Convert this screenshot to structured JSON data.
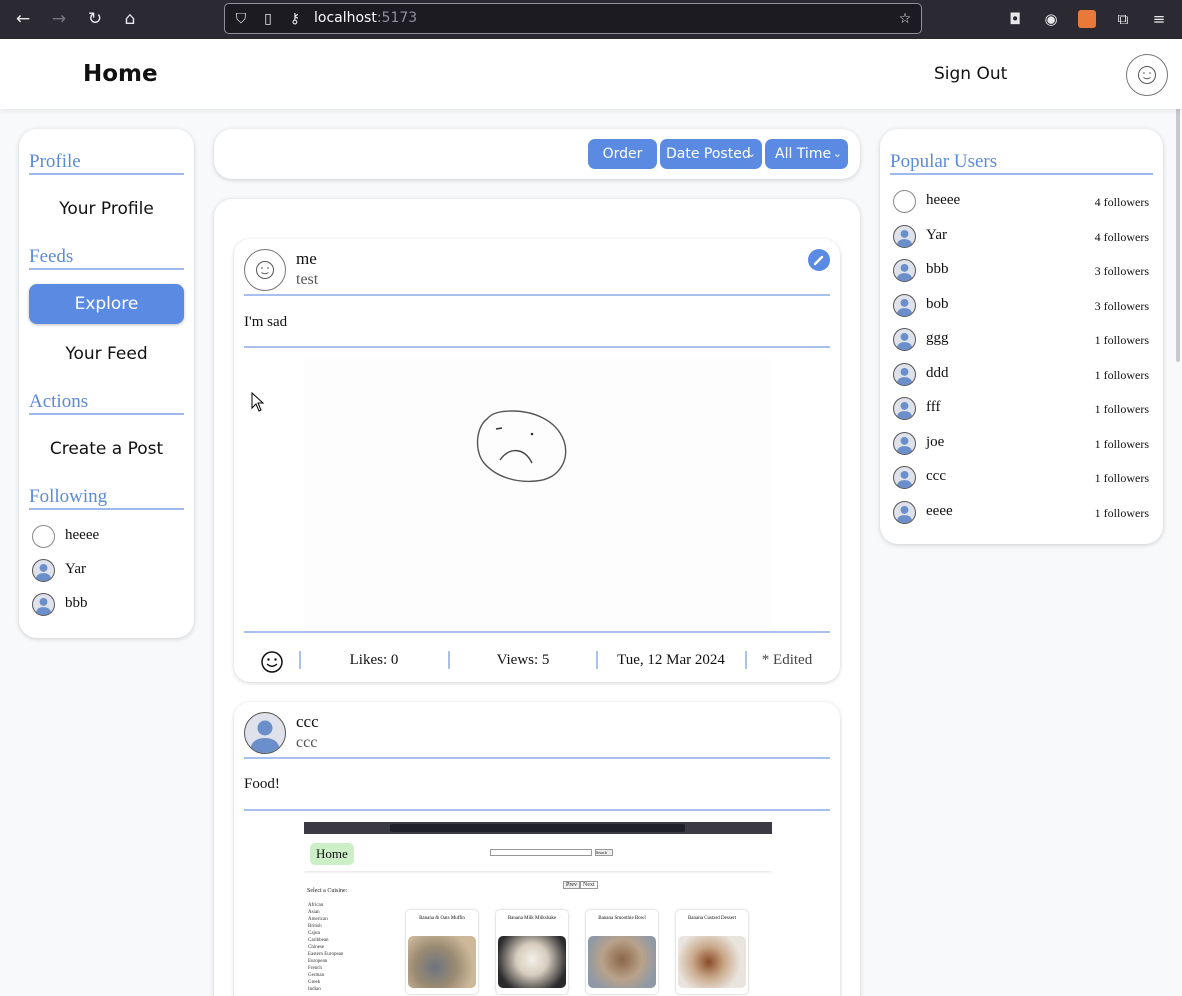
{
  "browser": {
    "url_host": "localhost",
    "url_port": ":5173"
  },
  "header": {
    "title": "Home",
    "sign_out": "Sign Out"
  },
  "sidebar": {
    "profile_title": "Profile",
    "your_profile": "Your Profile",
    "feeds_title": "Feeds",
    "explore": "Explore",
    "your_feed": "Your Feed",
    "actions_title": "Actions",
    "create_post": "Create a Post",
    "following_title": "Following",
    "following": [
      {
        "name": "heeee",
        "avatar": "blank"
      },
      {
        "name": "Yar",
        "avatar": "person"
      },
      {
        "name": "bbb",
        "avatar": "person"
      }
    ]
  },
  "filters": {
    "order": "Order",
    "sort": "Date Posted",
    "range": "All Time"
  },
  "posts": [
    {
      "author": "me",
      "handle": "test",
      "text": "I'm sad",
      "likes": "Likes: 0",
      "views": "Views: 5",
      "date": "Tue, 12 Mar 2024",
      "edited": "* Edited"
    },
    {
      "author": "ccc",
      "handle": "ccc",
      "text": "Food!",
      "mini": {
        "home": "Home",
        "search_btn": "Search",
        "btn1": "Prev",
        "btn2": "Next",
        "select": "Select a Cuisine:",
        "cuisines": [
          "African",
          "Asian",
          "American",
          "British",
          "Cajun",
          "Caribbean",
          "Chinese",
          "Eastern European",
          "European",
          "French",
          "German",
          "Greek",
          "Indian"
        ],
        "cards": [
          "Banana & Oats Muffin",
          "Banana Milk Milkshake",
          "Banana Smoothie Bowl",
          "Banana Custard Dessert"
        ]
      }
    }
  ],
  "popular": {
    "title": "Popular Users",
    "users": [
      {
        "name": "heeee",
        "followers": "4 followers",
        "avatar": "blank"
      },
      {
        "name": "Yar",
        "followers": "4 followers",
        "avatar": "person"
      },
      {
        "name": "bbb",
        "followers": "3 followers",
        "avatar": "person"
      },
      {
        "name": "bob",
        "followers": "3 followers",
        "avatar": "person"
      },
      {
        "name": "ggg",
        "followers": "1 followers",
        "avatar": "person"
      },
      {
        "name": "ddd",
        "followers": "1 followers",
        "avatar": "person"
      },
      {
        "name": "fff",
        "followers": "1 followers",
        "avatar": "person"
      },
      {
        "name": "joe",
        "followers": "1 followers",
        "avatar": "person"
      },
      {
        "name": "ccc",
        "followers": "1 followers",
        "avatar": "person"
      },
      {
        "name": "eeee",
        "followers": "1 followers",
        "avatar": "person"
      }
    ]
  },
  "colors": {
    "accent": "#5b8ae3",
    "divider": "#a8c0ee"
  }
}
